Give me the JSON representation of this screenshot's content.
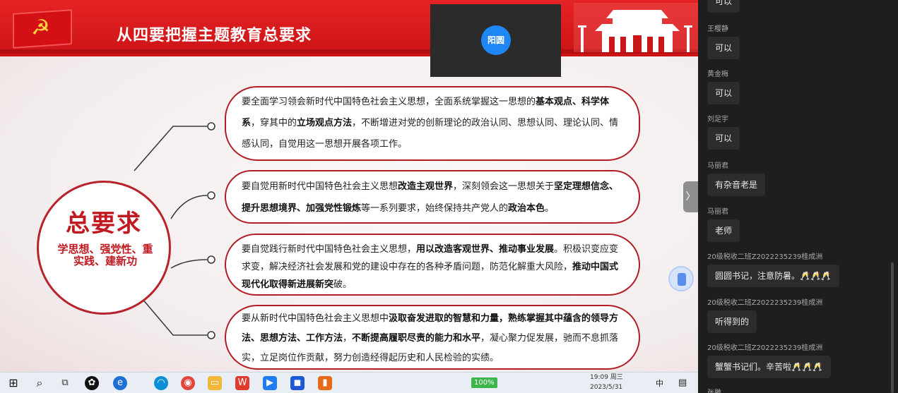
{
  "slide": {
    "title": "从四要把握主题教育总要求",
    "hub_title": "总要求",
    "hub_subtitle": "学思想、强党性、重实践、建新功",
    "items": [
      {
        "segments": [
          {
            "t": "要全面学习领会新时代中国特色社会主义思想，全面系统掌握这一思想的",
            "b": false
          },
          {
            "t": "基本观点、科学体系",
            "b": true
          },
          {
            "t": "，穿其中的",
            "b": false
          },
          {
            "t": "立场观点方法",
            "b": true
          },
          {
            "t": "，不断增进对党的创新理论的政治认同、思想认同、理论认同、情感认同，自觉用这一思想开展各项工作。",
            "b": false
          }
        ]
      },
      {
        "segments": [
          {
            "t": "要自觉用新时代中国特色社会主义思想",
            "b": false
          },
          {
            "t": "改造主观世界",
            "b": true
          },
          {
            "t": "，深刻领会这一思想关于",
            "b": false
          },
          {
            "t": "坚定理想信念、提升思想境界、加强党性锻炼",
            "b": true
          },
          {
            "t": "等一系列要求，始终保持共产党人的",
            "b": false
          },
          {
            "t": "政治本色",
            "b": true
          },
          {
            "t": "。",
            "b": false
          }
        ]
      },
      {
        "segments": [
          {
            "t": "要自觉践行新时代中国特色社会主义思想，",
            "b": false
          },
          {
            "t": "用以改造客观世界、推动事业发展",
            "b": true
          },
          {
            "t": "。积极识变应变求变，解决经济社会发展和党的建设中存在的各种矛盾问题，防范化解重大风险，",
            "b": false
          },
          {
            "t": "推动中国式现代化取得新进展新突",
            "b": true
          },
          {
            "t": "破。",
            "b": false
          }
        ]
      },
      {
        "segments": [
          {
            "t": "要从新时代中国特色社会主义思想中",
            "b": false
          },
          {
            "t": "汲取奋发进取的智慧和力量，熟练掌握其中蕴含的领导方法、思想方法、工作方法",
            "b": true
          },
          {
            "t": "，",
            "b": false
          },
          {
            "t": "不断提高履职尽责的能力和水平",
            "b": true
          },
          {
            "t": "，凝心聚力促发展，驰而不息抓落实，立足岗位作贡献，努力创造经得起历史和人民检验的实绩。",
            "b": false
          }
        ]
      }
    ]
  },
  "video": {
    "participant_name": "阳圆"
  },
  "chat": {
    "messages": [
      {
        "sender": "",
        "text": "可以"
      },
      {
        "sender": "王樱静",
        "text": "可以"
      },
      {
        "sender": "黄金梅",
        "text": "可以"
      },
      {
        "sender": "刘足宇",
        "text": "可以"
      },
      {
        "sender": "马丽君",
        "text": "有杂音老是"
      },
      {
        "sender": "马丽君",
        "text": "老师"
      },
      {
        "sender": "20级税收二班Z2022235239桂成洲",
        "text": "圆圆书记，注意防暑。🥂🥂🥂"
      },
      {
        "sender": "20级税收二班Z2022235239桂成洲",
        "text": "听得到的"
      },
      {
        "sender": "20级税收二班Z2022235239桂成洲",
        "text": "蟹蟹书记们。辛苦啦🥂🥂🥂"
      },
      {
        "sender": "张雕",
        "text": ""
      }
    ]
  },
  "taskbar": {
    "battery": "100%",
    "time": "19:09 周三",
    "date": "2023/5/31",
    "ime": "中"
  },
  "icons": {
    "start": "windows-start-icon",
    "search": "search-icon",
    "task_view": "task-view-icon",
    "scroll_arrow": "chevron-right-icon"
  },
  "colors": {
    "banner_red": "#e52324",
    "party_red": "#c01920",
    "chat_bg": "#1e1e1e",
    "avatar_blue": "#1e86f5"
  }
}
